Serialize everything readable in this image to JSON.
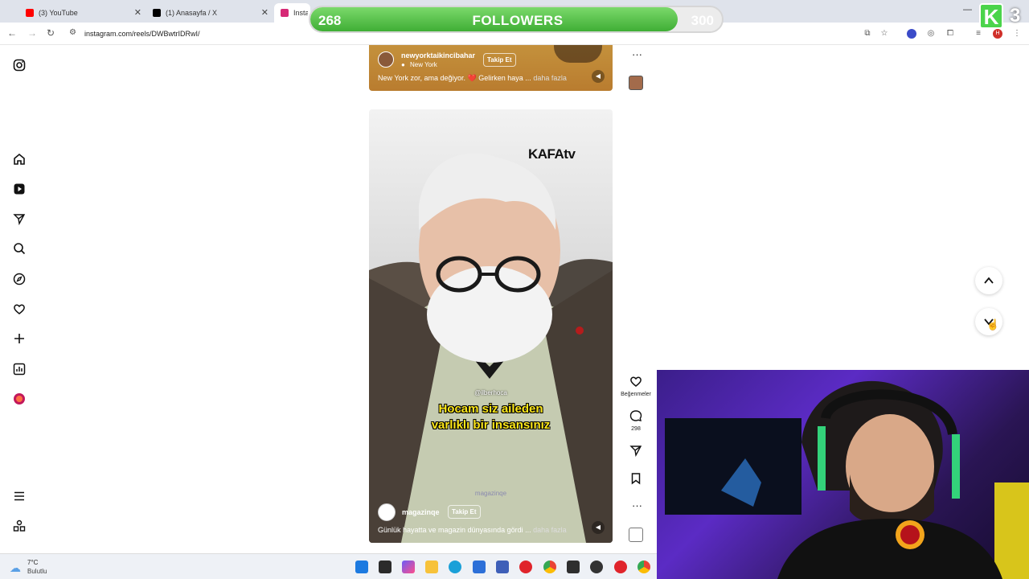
{
  "browser": {
    "tabs": [
      {
        "label": "(3) YouTube",
        "fav_color": "#ff0000"
      },
      {
        "label": "(1) Anasayfa / X",
        "fav_color": "#000000"
      },
      {
        "label": "Instagram",
        "fav_color": "#d62976"
      }
    ],
    "url": "instagram.com/reels/DWBwtrIDRwI/"
  },
  "overlay": {
    "followers_current": "268",
    "followers_label": "FOLLOWERS",
    "followers_goal": "300",
    "progress_fraction": 0.893,
    "k_letter": "K",
    "k_number": "3"
  },
  "sidebar": {
    "items": [
      "instagram-icon",
      "home-icon",
      "reels-icon",
      "send-icon",
      "search-icon",
      "explore-icon",
      "heart-icon",
      "plus-icon",
      "dashboard-icon",
      "profile-icon",
      "menu-icon",
      "threads-icon"
    ]
  },
  "reel_top": {
    "user": "newyorktaikincibahar",
    "location": "New York",
    "follow": "Takip Et",
    "caption": "New York zor, ama değiyor. ❤️ Gelirken haya ...",
    "more": "daha fazla"
  },
  "reel_main": {
    "brand": "KAFAtv",
    "handle": "@ilberhoca",
    "subtitle_line1": "Hocam siz aileden",
    "subtitle_line2": "varlıklı bir insansınız",
    "watermark": "magazinqe",
    "user": "magazinqe",
    "follow": "Takip Et",
    "caption": "Günlük hayatta ve magazin dünyasında gördi ...",
    "more": "daha fazla"
  },
  "rail": {
    "likes_label": "Beğenmeler",
    "comments_count": "298"
  },
  "taskbar": {
    "weather_temp": "7°C",
    "weather_desc": "Bulutlu"
  }
}
